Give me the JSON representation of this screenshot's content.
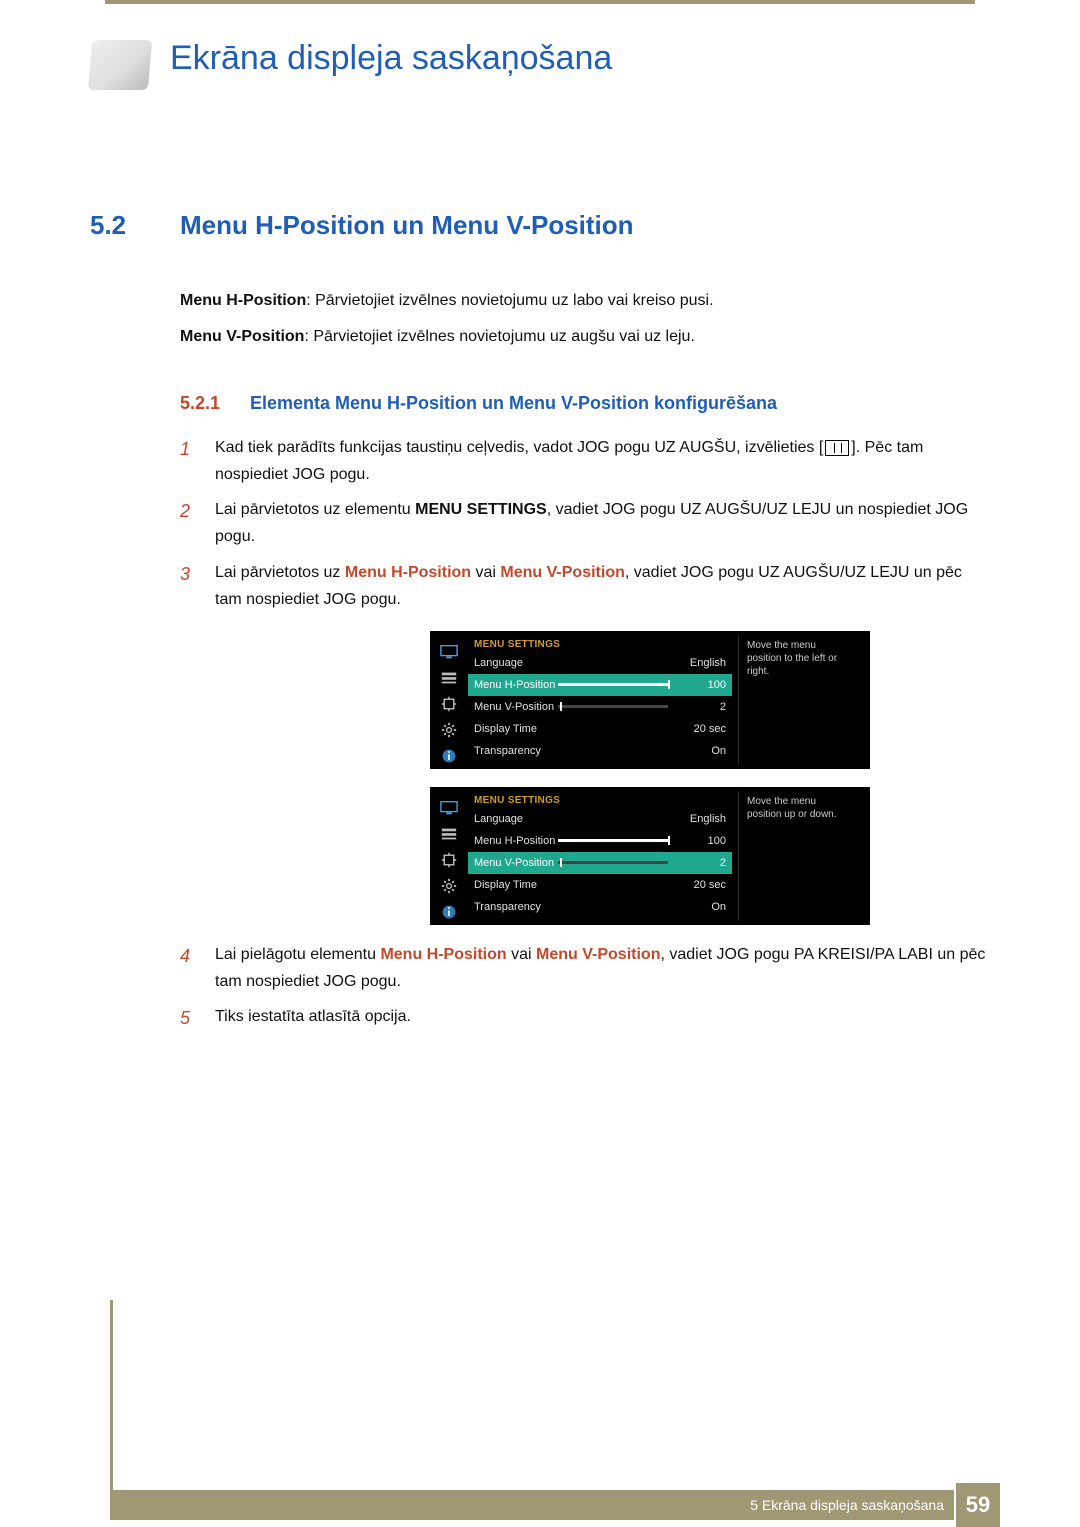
{
  "chapter_title": "Ekrāna displeja saskaņošana",
  "section_number": "5.2",
  "section_title": "Menu H-Position un Menu V-Position",
  "intro": {
    "h_label": "Menu H-Position",
    "h_desc": ": Pārvietojiet izvēlnes novietojumu uz labo vai kreiso pusi.",
    "v_label": "Menu V-Position",
    "v_desc": ": Pārvietojiet izvēlnes novietojumu uz augšu vai uz leju."
  },
  "subsection_number": "5.2.1",
  "subsection_title": "Elementa Menu H-Position un Menu V-Position konfigurēšana",
  "steps": {
    "s1a": "Kad tiek parādīts funkcijas taustiņu ceļvedis, vadot JOG pogu UZ AUGŠU, izvēlieties [",
    "s1b": "]. Pēc tam nospiediet JOG pogu.",
    "s2a": "Lai pārvietotos uz elementu ",
    "s2bbold": "MENU SETTINGS",
    "s2c": ", vadiet JOG pogu UZ AUGŠU/UZ LEJU un nospiediet JOG pogu.",
    "s3a": "Lai pārvietotos uz ",
    "s3b_orange1": "Menu H-Position",
    "s3c_or": " vai ",
    "s3d_orange2": "Menu V-Position",
    "s3e": ", vadiet JOG pogu UZ AUGŠU/UZ LEJU un pēc tam nospiediet JOG pogu.",
    "s4a": "Lai pielāgotu elementu ",
    "s4b_orange1": "Menu H-Position",
    "s4c_or": " vai ",
    "s4d_orange2": "Menu V-Position",
    "s4e": ", vadiet JOG pogu PA KREISI/PA LABI un pēc tam nospiediet JOG pogu.",
    "s5": "Tiks iestatīta atlasītā opcija."
  },
  "osd": {
    "header": "MENU SETTINGS",
    "labels": {
      "language": "Language",
      "hpos": "Menu H-Position",
      "vpos": "Menu V-Position",
      "display_time": "Display Time",
      "transparency": "Transparency"
    },
    "values": {
      "language": "English",
      "hpos": "100",
      "vpos": "2",
      "display_time": "20 sec",
      "transparency": "On"
    },
    "desc_h": "Move the menu position to the left or right.",
    "desc_v": "Move the menu position up or down."
  },
  "footer": {
    "chapter_ref": "5 Ekrāna displeja saskaņošana",
    "page_number": "59"
  }
}
